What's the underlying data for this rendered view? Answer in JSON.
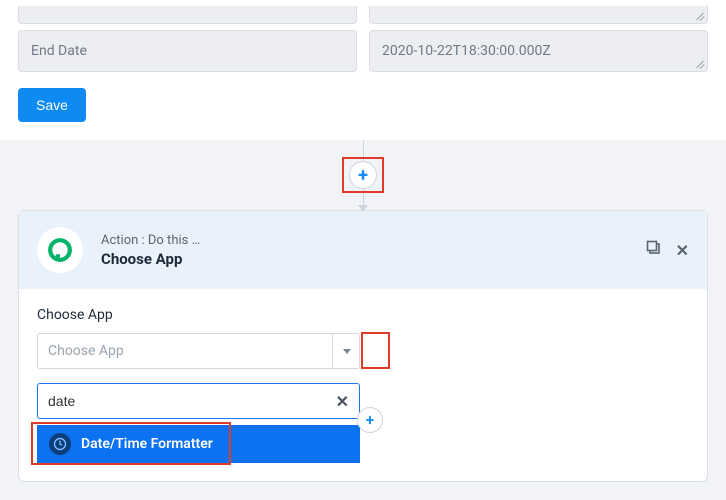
{
  "form": {
    "end_date_label": "End Date",
    "end_date_value": "2020-10-22T18:30:00.000Z",
    "save_label": "Save"
  },
  "action": {
    "subtitle": "Action : Do this …",
    "title": "Choose App",
    "choose_label": "Choose App",
    "select_placeholder": "Choose App",
    "search_value": "date",
    "option_label": "Date/Time Formatter"
  },
  "icons": {
    "plus": "+",
    "close": "✕",
    "copy": "⧉",
    "clear": "✕"
  }
}
